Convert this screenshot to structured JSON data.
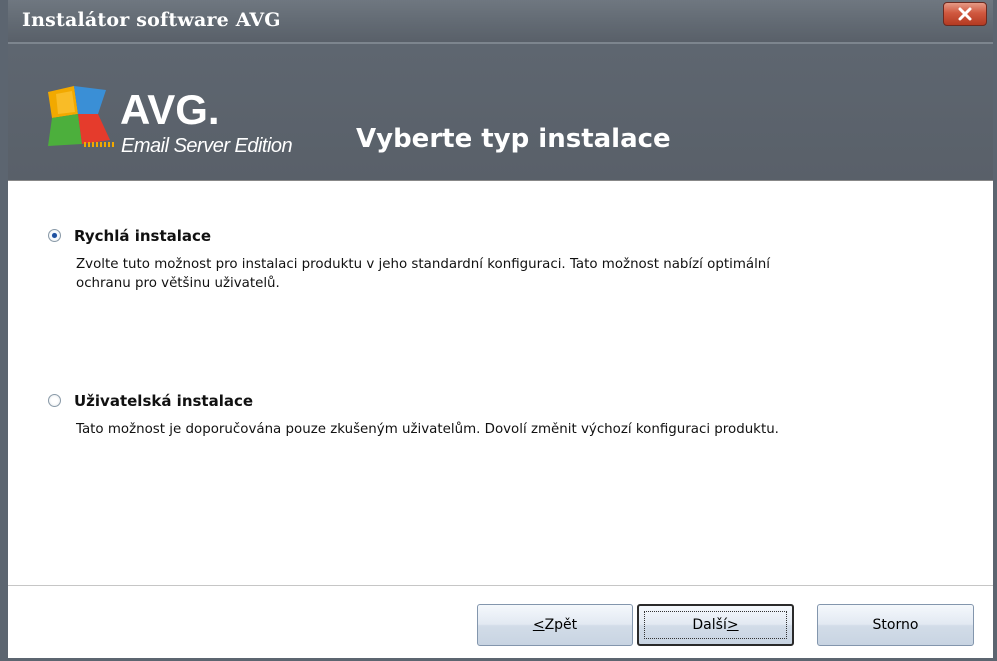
{
  "window": {
    "title": "Instalátor software AVG",
    "close_label": "X"
  },
  "header": {
    "logo_text": "AVG.",
    "logo_subtitle": "Email Server Edition",
    "title": "Vyberte typ instalace"
  },
  "options": [
    {
      "label": "Rychlá instalace",
      "description": "Zvolte tuto možnost pro instalaci produktu v jeho standardní konfiguraci. Tato možnost nabízí optimální ochranu pro většinu uživatelů.",
      "selected": true
    },
    {
      "label": "Uživatelská instalace",
      "description": "Tato možnost je doporučována pouze zkušeným uživatelům. Dovolí změnit výchozí konfiguraci produktu.",
      "selected": false
    }
  ],
  "buttons": {
    "back_prefix": "<",
    "back_label": " Zpět",
    "next_label": "Další ",
    "next_suffix": ">",
    "cancel_label": "Storno"
  },
  "colors": {
    "titlebar": "#626a73",
    "header_bg": "#5b636c",
    "close_button": "#c9452a",
    "radio_dot": "#1e4f9e"
  }
}
